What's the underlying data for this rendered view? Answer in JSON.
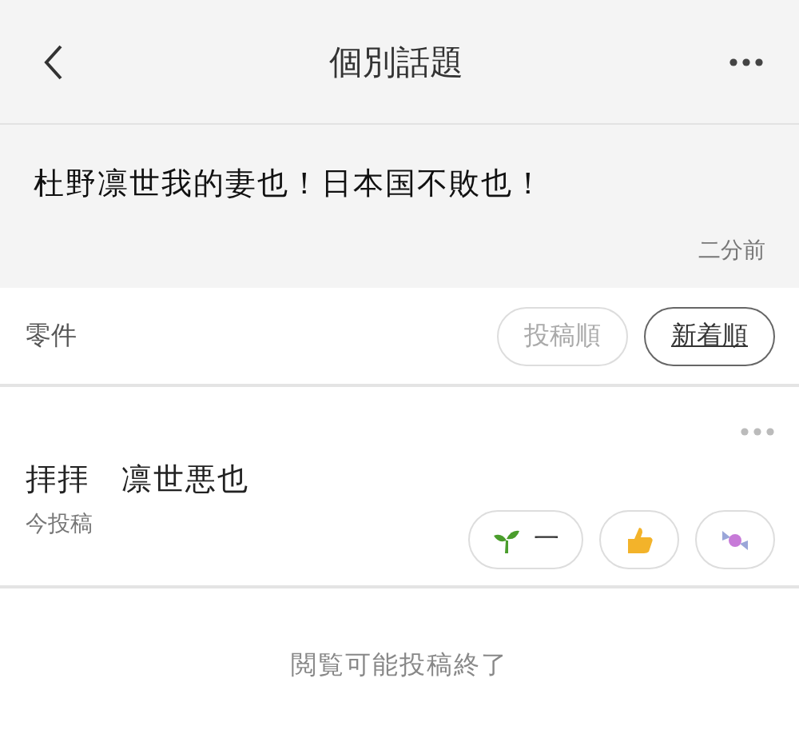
{
  "header": {
    "title": "個別話題"
  },
  "topic": {
    "text": "杜野凛世我的妻也！日本国不敗也！",
    "time": "二分前"
  },
  "replies": {
    "count": "零件",
    "sort": [
      {
        "label": "投稿順",
        "selected": false
      },
      {
        "label": "新着順",
        "selected": true
      }
    ]
  },
  "comments": [
    {
      "text": "拝拝　凛世悪也",
      "time": "今投稿",
      "reactions": [
        {
          "kind": "sprout",
          "count": "一"
        },
        {
          "kind": "thumb"
        },
        {
          "kind": "candy"
        }
      ]
    }
  ],
  "footer": "閲覧可能投稿終了"
}
